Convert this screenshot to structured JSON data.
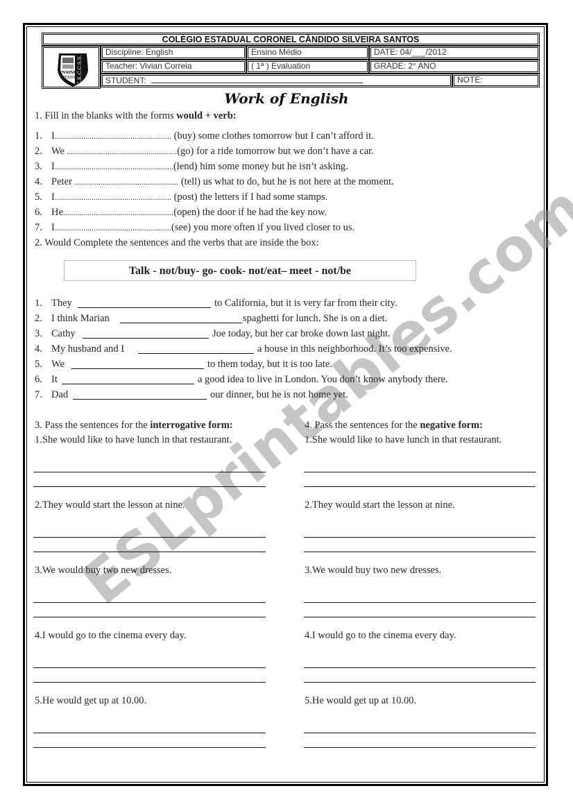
{
  "header": {
    "school_name": "COLÉGIO ESTADUAL CORONEL CÂNDIDO SILVEIRA SANTOS",
    "discipline": "Discipline: English",
    "level": "Ensino Médio",
    "date": "DATE: 04/___/2012",
    "teacher": "Teacher: Vivian Correia",
    "evaluation": "( 1ª )  Evaluation",
    "grade": "GRADE: 2° ANO",
    "student_label": "STUDENT:",
    "note_label": "NOTE:",
    "logo": {
      "icon": "school-crest-icon",
      "text_left": "ENSINO MÉDIO",
      "text_right": "C.E.C.C.S.S."
    }
  },
  "title": "Work of English",
  "section1": {
    "instruction_prefix": "1. Fill in the blanks with the forms ",
    "instruction_bold": "would + verb:",
    "items": [
      {
        "num": "1.",
        "subject": "I",
        "dots": ".........................................................",
        "rest": " (buy) some clothes tomorrow but I can’t afford it."
      },
      {
        "num": "2.",
        "subject": "We",
        "dots": " ......................................................",
        "rest": "(go) for a ride tomorrow but we don’t have a car."
      },
      {
        "num": "3.",
        "subject": "I",
        "dots": "..........................................................",
        "rest": "(lend) him some money but he isn’t asking."
      },
      {
        "num": "4.",
        "subject": "Peter",
        "dots": " ...................................................",
        "rest": " (tell) us what to do, but he is not here at the moment."
      },
      {
        "num": "5.",
        "subject": "I",
        "dots": ".........................................................",
        "rest": " (post) the letters if I had some stamps."
      },
      {
        "num": "6.",
        "subject": "He",
        "dots": "......................................................",
        "rest": "(open) the door if he had the key now."
      },
      {
        "num": "7.",
        "subject": "I",
        "dots": ".........................................................",
        "rest": "(see) you more often if you lived closer to us."
      }
    ]
  },
  "section2": {
    "instruction": "2. Would Complete the sentences and the verbs that are inside the box:",
    "verb_box": "Talk - not/buy- go- cook- not/eat– meet - not/be",
    "items": [
      {
        "num": "1.",
        "before": "They",
        "after": "to California, but it is very far from their city."
      },
      {
        "num": "2.",
        "before": "I think Marian",
        "after": "spaghetti for lunch. She is on a diet."
      },
      {
        "num": "3.",
        "before": "Cathy",
        "after": "Joe today, but her car broke down last night."
      },
      {
        "num": "4.",
        "before": "My husband and I",
        "after": "a house in this neighborhood. It’s too expensive."
      },
      {
        "num": "5.",
        "before": "We",
        "after": "to them today, but it is too late."
      },
      {
        "num": "6.",
        "before": "It",
        "after": "a good idea to live in London. You don’t know anybody there."
      },
      {
        "num": "7.",
        "before": "Dad",
        "after": "our dinner, but he is not home yet."
      }
    ]
  },
  "section3": {
    "instruction_prefix": "3. Pass the sentences for the ",
    "instruction_bold": "interrogative form:",
    "items": [
      "1.She would like to have lunch in that restaurant.",
      "2.They would start the lesson at nine.",
      "3.We would buy two new dresses.",
      "4.I would go to the cinema every day.",
      "5.He would get up at 10.00."
    ]
  },
  "section4": {
    "instruction_prefix": "4. Pass the sentences for the ",
    "instruction_bold": "negative form:",
    "items": [
      "1.She would like to have lunch in that restaurant.",
      "2.They would start the lesson at nine.",
      "3.We would buy two new dresses.",
      "4.I would go to the cinema every day.",
      "5.He would get up at 10.00."
    ]
  },
  "watermark": "ESLprintables.com"
}
